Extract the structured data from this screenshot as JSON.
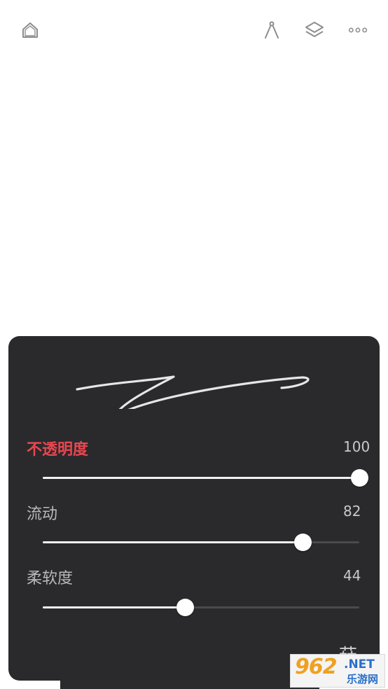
{
  "toolbar": {
    "icons": [
      "home-icon",
      "ruler-icon",
      "layers-icon",
      "more-icon"
    ]
  },
  "brush_panel": {
    "sliders": [
      {
        "label": "不透明度",
        "value": "100",
        "fraction": 1.0,
        "active": true
      },
      {
        "label": "流动",
        "value": "82",
        "fraction": 0.82,
        "active": false
      },
      {
        "label": "柔软度",
        "value": "44",
        "fraction": 0.45,
        "active": false
      }
    ],
    "partial_label": "菇"
  },
  "watermark": {
    "number": "962",
    "suffix": ".NET",
    "sub": "乐游网"
  },
  "colors": {
    "panel_bg": "#2a2a2d",
    "active_label": "#e8474f",
    "slider_fill": "#f2f2f2",
    "slider_track": "#4a4a4d"
  }
}
